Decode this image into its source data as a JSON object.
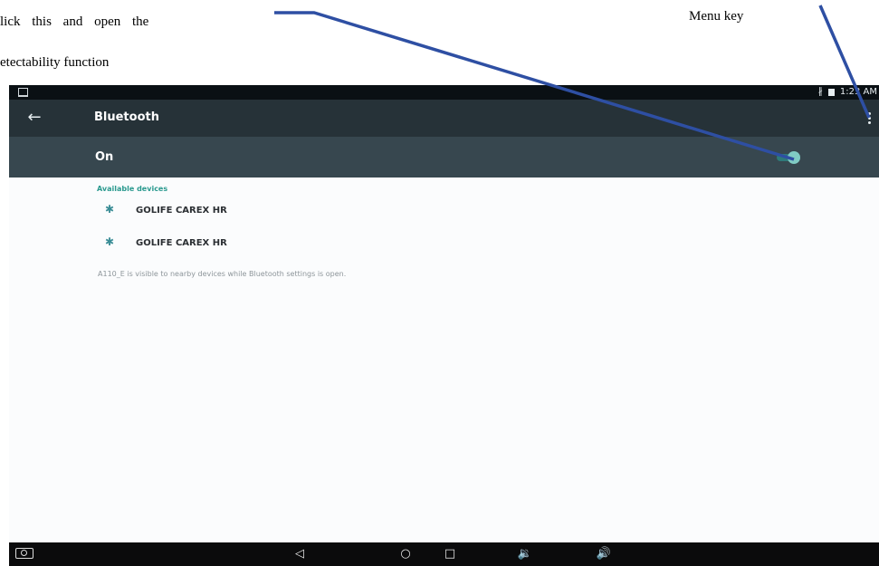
{
  "annotations": {
    "detect_line_1": "lick this and open the",
    "detect_line_2": "etectability function",
    "menu_key": "Menu key",
    "line_color": "#2e4fa3"
  },
  "statusbar": {
    "time": "1:23 AM",
    "bluetooth_icon": "bluetooth-icon",
    "sim_icon": "sim-icon"
  },
  "toolbar": {
    "title": "Bluetooth",
    "back_icon": "arrow-left-icon",
    "menu_icon": "overflow-menu-icon",
    "color": "#263238"
  },
  "switchbar": {
    "label": "On",
    "state": "on",
    "color": "#37474f",
    "accent": "#80cbc4"
  },
  "content": {
    "section_header": "Available devices",
    "devices": [
      {
        "name": "GOLIFE CAREX HR",
        "icon": "bluetooth-icon"
      },
      {
        "name": "GOLIFE CAREX HR",
        "icon": "bluetooth-icon"
      }
    ],
    "visibility_note": "A110_E is visible to nearby devices while Bluetooth settings is open."
  },
  "navbar": {
    "screenshot_icon": "camera-icon",
    "back_glyph": "◁",
    "home_glyph": "○",
    "recents_glyph": "□",
    "vol_down_glyph": "🔉",
    "vol_up_glyph": "🔊"
  }
}
